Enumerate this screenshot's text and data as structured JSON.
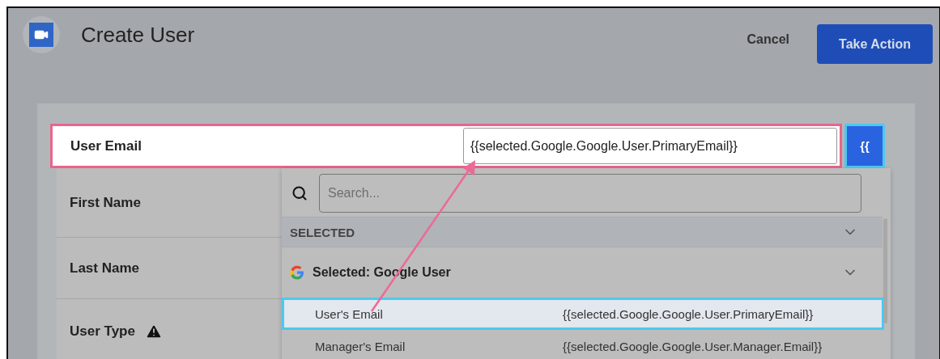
{
  "header": {
    "title": "Create User",
    "cancel": "Cancel",
    "primary_action": "Take Action"
  },
  "fields": [
    {
      "label": "User Email",
      "value": "{{selected.Google.Google.User.PrimaryEmail}}",
      "highlighted": true,
      "warning": false
    },
    {
      "label": "First Name",
      "highlighted": false,
      "warning": false
    },
    {
      "label": "Last Name",
      "highlighted": false,
      "warning": false
    },
    {
      "label": "User Type",
      "highlighted": false,
      "warning": true
    }
  ],
  "variable_button": "{{",
  "picker": {
    "search_placeholder": "Search...",
    "section": "SELECTED",
    "group": "Selected: Google User",
    "items": [
      {
        "label": "User's Email",
        "value": "{{selected.Google.Google.User.PrimaryEmail}}",
        "selected": true
      },
      {
        "label": "Manager's Email",
        "value": "{{selected.Google.Google.User.Manager.Email}}",
        "selected": false
      }
    ]
  }
}
